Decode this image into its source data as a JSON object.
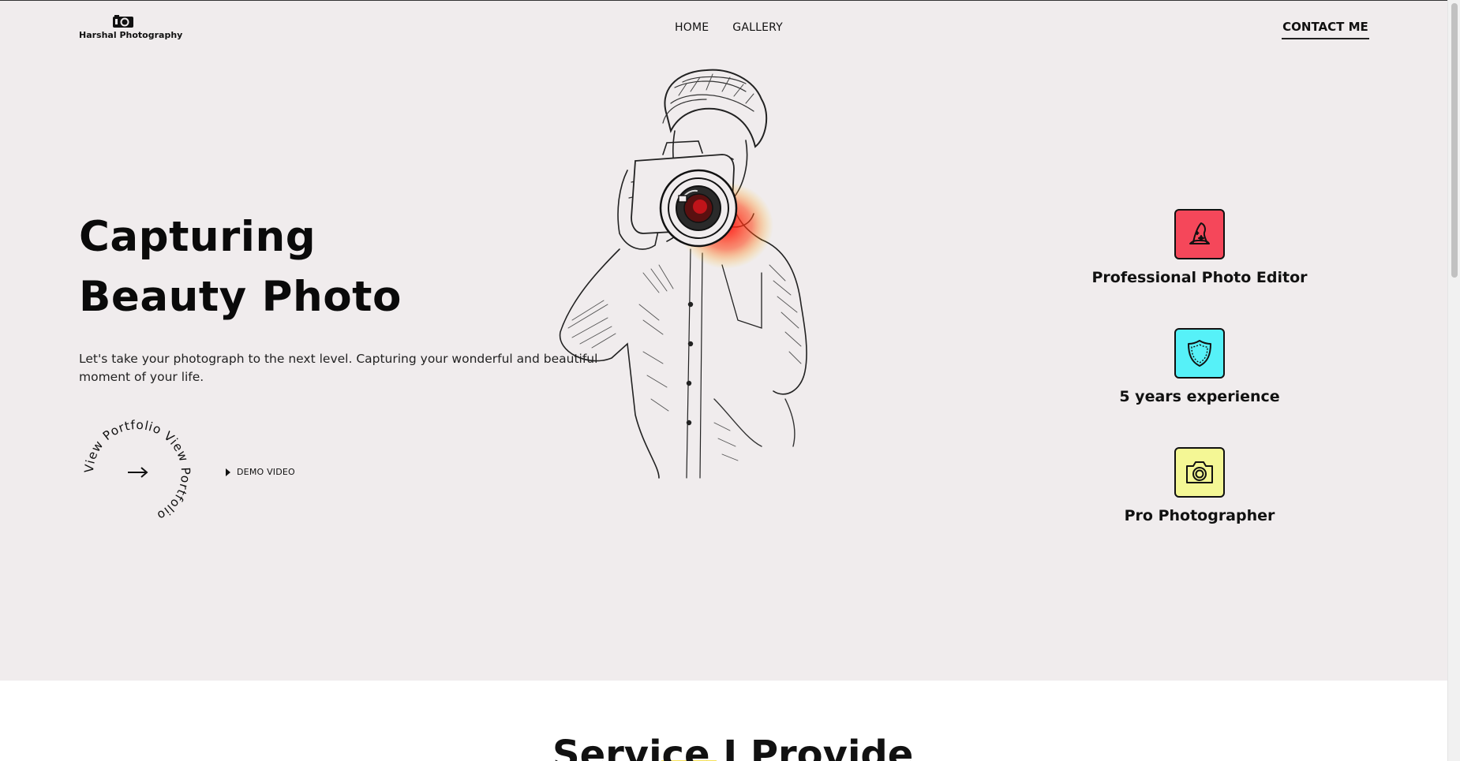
{
  "brand": {
    "name": "Harshal Photography",
    "logo_icon": "camera-icon"
  },
  "nav": {
    "items": [
      {
        "label": "HOME"
      },
      {
        "label": "GALLERY"
      }
    ],
    "contact_label": "CONTACT ME"
  },
  "hero": {
    "title_line1": "Capturing",
    "title_line2": "Beauty Photo",
    "description": "Let's take your photograph to the next level. Capturing your wonderful and beautiful moment of your life.",
    "portfolio_badge_text": "View Portfolio View Portfolio ",
    "demo_label": "DEMO VIDEO",
    "illustration": "photographer-sketch"
  },
  "features": [
    {
      "label": "Professional Photo Editor",
      "icon": "wizard-hat-icon",
      "color": "#f5475a"
    },
    {
      "label": "5 years experience",
      "icon": "shield-icon",
      "color": "#56f1f8"
    },
    {
      "label": "Pro Photographer",
      "icon": "camera-icon",
      "color": "#f4f795"
    }
  ],
  "services": {
    "title": "Service I Provide",
    "accent": "#f6e25a"
  },
  "colors": {
    "hero_bg": "#f0eced",
    "text": "#111111"
  }
}
